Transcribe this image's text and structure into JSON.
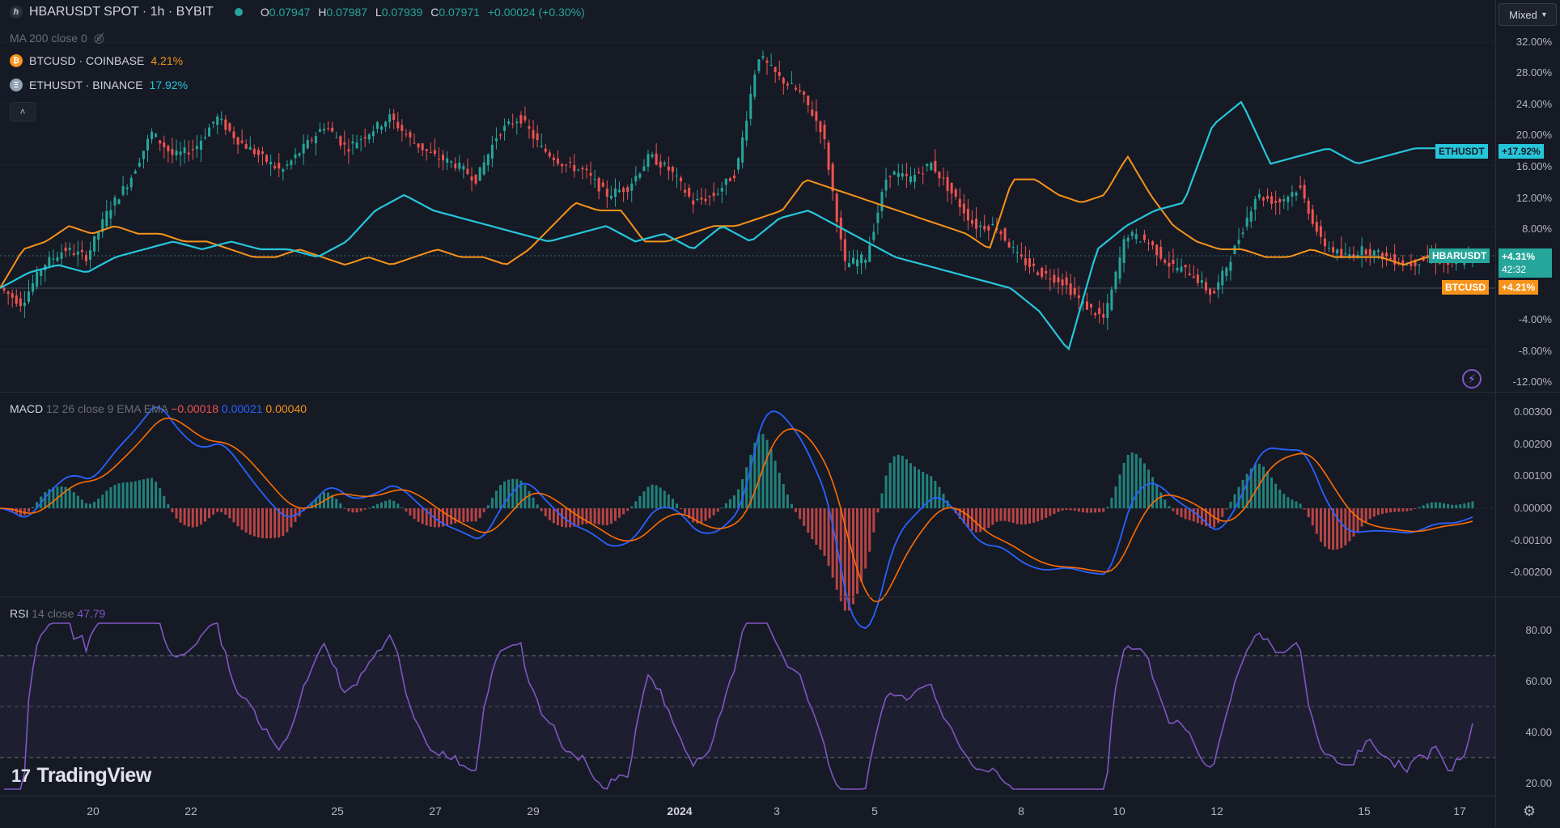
{
  "header": {
    "symbol": "HBARUSDT SPOT · 1h · BYBIT",
    "open_label": "O",
    "open": "0.07947",
    "high_label": "H",
    "high": "0.07987",
    "low_label": "L",
    "low": "0.07939",
    "close_label": "C",
    "close": "0.07971",
    "change": "+0.00024 (+0.30%)"
  },
  "indicators": {
    "ma": "MA 200 close 0",
    "btc": {
      "name": "BTCUSD · COINBASE",
      "value": "4.21%",
      "icon": "₿"
    },
    "eth": {
      "name": "ETHUSDT · BINANCE",
      "value": "17.92%",
      "icon": "Ξ"
    },
    "collapse_icon": "˄"
  },
  "price_scale": {
    "mode": "Mixed",
    "ticks": [
      "32.00%",
      "28.00%",
      "24.00%",
      "20.00%",
      "16.00%",
      "12.00%",
      "8.00%",
      "-4.00%",
      "-8.00%",
      "-12.00%"
    ],
    "tags": {
      "eth_sym": "ETHUSDT",
      "eth_val": "+17.92%",
      "hbar_sym": "HBARUSDT",
      "hbar_val": "+4.31%",
      "hbar_timer": "42:32",
      "btc_sym": "BTCUSD",
      "btc_val": "+4.21%"
    }
  },
  "macd": {
    "label": "MACD",
    "params": "12 26 close 9 EMA EMA",
    "hist": "−0.00018",
    "macd": "0.00021",
    "signal": "0.00040",
    "ticks": [
      "0.00300",
      "0.00200",
      "0.00100",
      "0.00000",
      "-0.00100",
      "-0.00200"
    ]
  },
  "rsi": {
    "label": "RSI",
    "params": "14 close",
    "value": "47.79",
    "ticks": [
      "80.00",
      "60.00",
      "40.00",
      "20.00"
    ]
  },
  "time_axis": [
    "20",
    "22",
    "25",
    "27",
    "29",
    "2024",
    "3",
    "5",
    "8",
    "10",
    "12",
    "15",
    "17"
  ],
  "brand": "TradingView",
  "colors": {
    "background": "#161a25",
    "up": "#26a69a",
    "down": "#ef5350",
    "btc": "#f7931a",
    "eth": "#26c6da",
    "macd": "#2962ff",
    "signal": "#ff6d00",
    "rsi": "#7e57c2"
  },
  "chart_data": {
    "type": "line",
    "hbar_pct": [
      0,
      -2,
      3,
      5,
      4,
      10,
      14,
      20,
      17,
      18,
      22,
      19,
      17,
      15,
      18,
      21,
      18,
      20,
      22,
      19,
      17,
      16,
      14,
      20,
      22,
      18,
      16,
      15,
      12,
      13,
      17,
      15,
      11,
      12,
      15,
      30,
      27,
      25,
      20,
      3,
      4,
      15,
      14,
      16,
      12,
      8,
      8,
      4,
      2,
      1,
      -2,
      -4,
      7,
      6,
      3,
      2,
      -1,
      5,
      12,
      11,
      13,
      6,
      4,
      5,
      4,
      3,
      4,
      3,
      4
    ],
    "btc_pct": [
      0,
      5,
      6,
      8,
      7,
      8,
      7,
      7,
      6,
      6,
      5,
      4,
      4,
      5,
      4,
      3,
      4,
      3,
      4,
      5,
      4,
      4,
      3,
      5,
      8,
      11,
      10,
      10,
      6,
      6,
      7,
      8,
      8,
      9,
      10,
      14,
      13,
      12,
      11,
      10,
      9,
      8,
      7,
      5,
      14,
      14,
      12,
      11,
      12,
      17,
      12,
      8,
      6,
      5,
      5,
      4,
      4,
      5,
      4,
      4,
      4,
      3,
      4,
      4,
      5
    ],
    "eth_pct": [
      0,
      2,
      3,
      2,
      4,
      5,
      6,
      5,
      6,
      5,
      5,
      4,
      6,
      10,
      12,
      10,
      9,
      8,
      7,
      6,
      7,
      8,
      6,
      7,
      5,
      8,
      6,
      9,
      10,
      8,
      6,
      4,
      3,
      2,
      1,
      0,
      -3,
      -8,
      5,
      8,
      10,
      11,
      21,
      24,
      16,
      17,
      18,
      16,
      17,
      18,
      18,
      17
    ]
  }
}
